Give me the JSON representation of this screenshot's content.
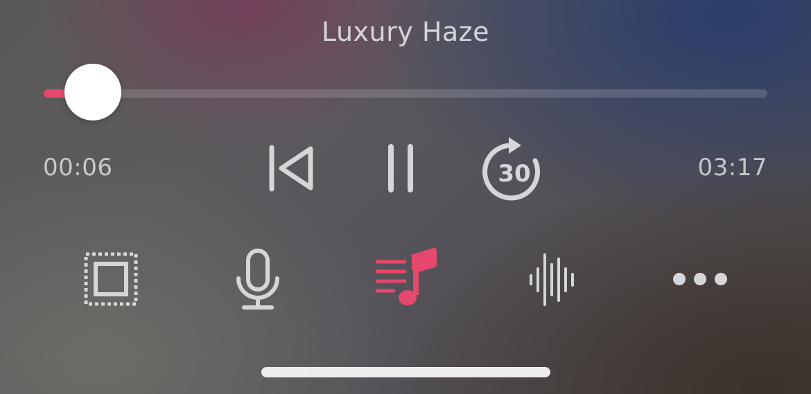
{
  "now_playing": {
    "title": "Luxury Haze"
  },
  "playback": {
    "elapsed": "00:06",
    "total": "03:17",
    "progress_fraction": 0.03,
    "state": "playing"
  },
  "controls": {
    "previous_icon": "skip-back-icon",
    "pause_icon": "pause-icon",
    "skip_forward_icon": "skip-forward-30-icon",
    "skip_forward_seconds": "30"
  },
  "toolbar": {
    "items": [
      {
        "name": "airplay-icon",
        "active": false
      },
      {
        "name": "microphone-icon",
        "active": false
      },
      {
        "name": "lyrics-music-icon",
        "active": true
      },
      {
        "name": "waveform-icon",
        "active": false
      },
      {
        "name": "more-icon",
        "active": false
      }
    ]
  },
  "colors": {
    "accent": "#e6486d",
    "icon": "#d6d6d8",
    "text": "#e2e2e6"
  }
}
